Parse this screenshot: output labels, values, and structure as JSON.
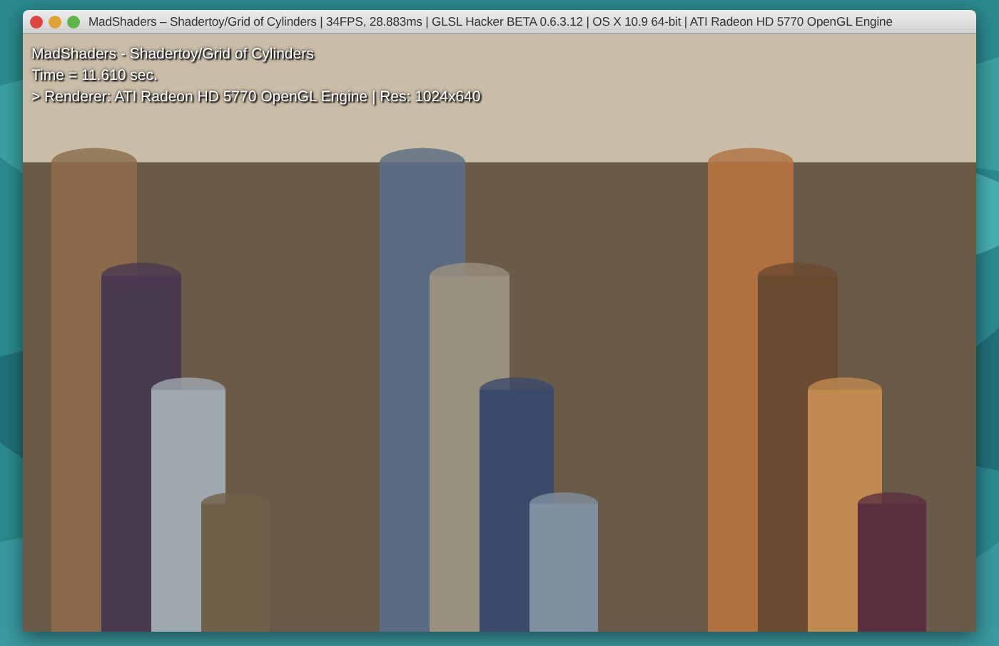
{
  "window": {
    "title": "MadShaders – Shadertoy/Grid of Cylinders | 34FPS, 28.883ms | GLSL Hacker BETA 0.6.3.12 | OS X 10.9  64-bit | ATI Radeon HD 5770 OpenGL Engine"
  },
  "overlay": [
    "MadShaders - Shadertoy/Grid of Cylinders",
    "Time = 11.610 sec.",
    "> Renderer: ATI Radeon HD 5770 OpenGL Engine | Res: 1024x640"
  ]
}
